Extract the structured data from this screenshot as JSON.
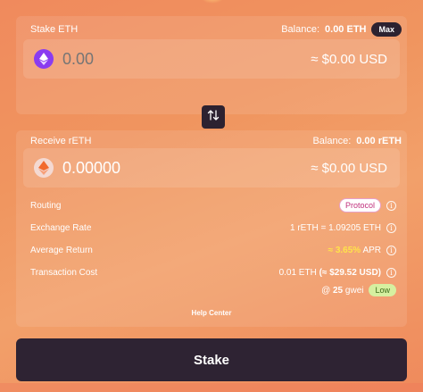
{
  "stake": {
    "label": "Stake ETH",
    "balance_prefix": "Balance:",
    "balance_value": "0.00 ETH",
    "max_label": "Max",
    "amount_placeholder": "0.00",
    "usd_value": "≈ $0.00 USD",
    "token_icon": "eth-icon"
  },
  "receive": {
    "label": "Receive rETH",
    "balance_prefix": "Balance:",
    "balance_value": "0.00 rETH",
    "amount_value": "0.00000",
    "usd_value": "≈ $0.00 USD",
    "token_icon": "reth-icon"
  },
  "details": {
    "routing_label": "Routing",
    "routing_value": "Protocol",
    "exchange_label": "Exchange Rate",
    "exchange_value": "1 rETH = 1.09205 ETH",
    "return_label": "Average Return",
    "return_value": "≈ 3.65%",
    "return_unit": "APR",
    "cost_label": "Transaction Cost",
    "cost_eth": "0.01 ETH",
    "cost_usd": "(≈ $29.52 USD)",
    "gas_prefix": "@",
    "gas_value": "25",
    "gas_unit": "gwei",
    "gas_level": "Low"
  },
  "help_label": "Help Center",
  "stake_button": "Stake",
  "colors": {
    "accent_dark": "#2e2333",
    "eth_purple": "#8a3cf0",
    "apr_yellow": "#ffe34a",
    "protocol_pink": "#c0307c",
    "low_green": "#d6f0a0"
  }
}
